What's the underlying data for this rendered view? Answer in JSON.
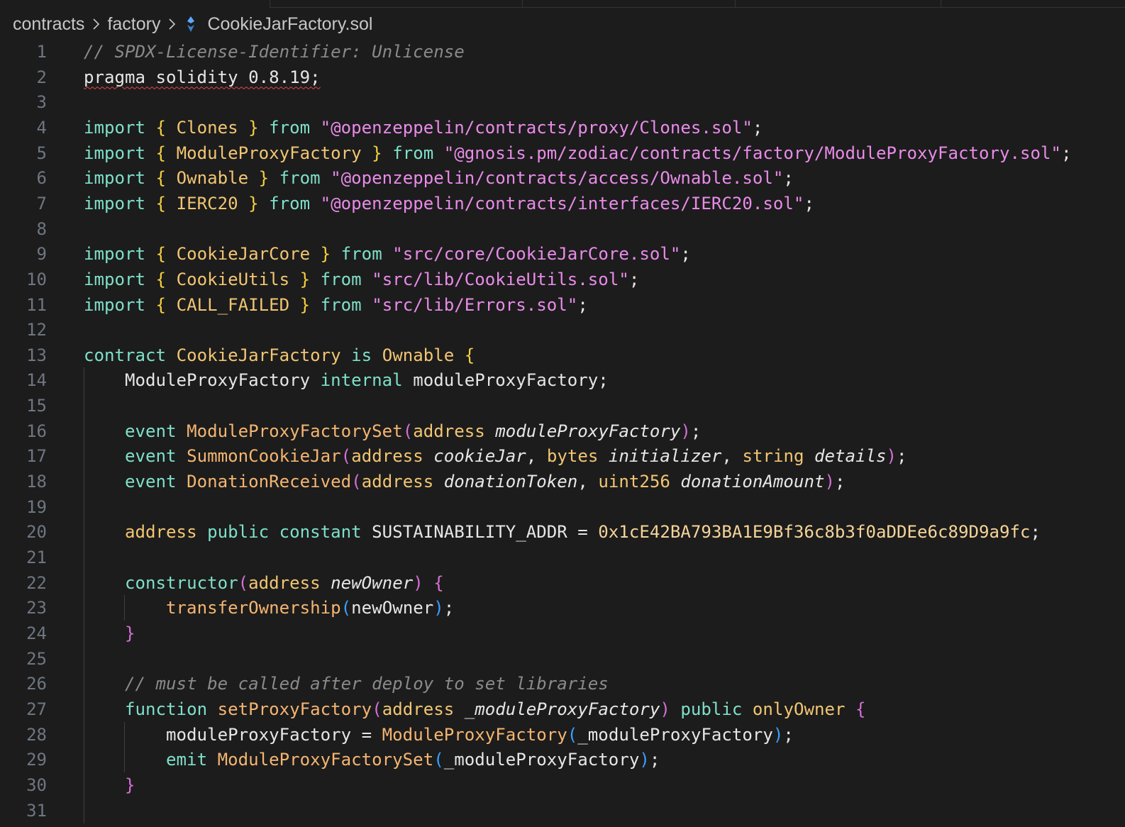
{
  "breadcrumb": {
    "items": [
      "contracts",
      "factory"
    ],
    "file": "CookieJarFactory.sol",
    "file_icon": "solidity-file-icon"
  },
  "editor": {
    "lines": [
      {
        "n": "1",
        "tokens": [
          [
            "cm",
            "// SPDX-License-Identifier: Unlicense"
          ]
        ]
      },
      {
        "n": "2",
        "tokens": [
          [
            "plain squig",
            "pragma solidity 0.8.19;"
          ]
        ]
      },
      {
        "n": "3",
        "tokens": []
      },
      {
        "n": "4",
        "tokens": [
          [
            "kw",
            "import "
          ],
          [
            "br",
            "{ "
          ],
          [
            "ty",
            "Clones "
          ],
          [
            "br",
            "} "
          ],
          [
            "kw",
            "from "
          ],
          [
            "str",
            "\"@openzeppelin/contracts/proxy/Clones.sol\""
          ],
          [
            "plain",
            ";"
          ]
        ]
      },
      {
        "n": "5",
        "tokens": [
          [
            "kw",
            "import "
          ],
          [
            "br",
            "{ "
          ],
          [
            "ty",
            "ModuleProxyFactory "
          ],
          [
            "br",
            "} "
          ],
          [
            "kw",
            "from "
          ],
          [
            "str",
            "\"@gnosis.pm/zodiac/contracts/factory/ModuleProxyFactory.sol\""
          ],
          [
            "plain",
            ";"
          ]
        ]
      },
      {
        "n": "6",
        "tokens": [
          [
            "kw",
            "import "
          ],
          [
            "br",
            "{ "
          ],
          [
            "ty",
            "Ownable "
          ],
          [
            "br",
            "} "
          ],
          [
            "kw",
            "from "
          ],
          [
            "str",
            "\"@openzeppelin/contracts/access/Ownable.sol\""
          ],
          [
            "plain",
            ";"
          ]
        ]
      },
      {
        "n": "7",
        "tokens": [
          [
            "kw",
            "import "
          ],
          [
            "br",
            "{ "
          ],
          [
            "ty",
            "IERC20 "
          ],
          [
            "br",
            "} "
          ],
          [
            "kw",
            "from "
          ],
          [
            "str",
            "\"@openzeppelin/contracts/interfaces/IERC20.sol\""
          ],
          [
            "plain",
            ";"
          ]
        ]
      },
      {
        "n": "8",
        "tokens": []
      },
      {
        "n": "9",
        "tokens": [
          [
            "kw",
            "import "
          ],
          [
            "br",
            "{ "
          ],
          [
            "ty",
            "CookieJarCore "
          ],
          [
            "br",
            "} "
          ],
          [
            "kw",
            "from "
          ],
          [
            "str",
            "\"src/core/CookieJarCore.sol\""
          ],
          [
            "plain",
            ";"
          ]
        ]
      },
      {
        "n": "10",
        "tokens": [
          [
            "kw",
            "import "
          ],
          [
            "br",
            "{ "
          ],
          [
            "ty",
            "CookieUtils "
          ],
          [
            "br",
            "} "
          ],
          [
            "kw",
            "from "
          ],
          [
            "str",
            "\"src/lib/CookieUtils.sol\""
          ],
          [
            "plain",
            ";"
          ]
        ]
      },
      {
        "n": "11",
        "tokens": [
          [
            "kw",
            "import "
          ],
          [
            "br",
            "{ "
          ],
          [
            "ty",
            "CALL_FAILED "
          ],
          [
            "br",
            "} "
          ],
          [
            "kw",
            "from "
          ],
          [
            "str",
            "\"src/lib/Errors.sol\""
          ],
          [
            "plain",
            ";"
          ]
        ]
      },
      {
        "n": "12",
        "tokens": []
      },
      {
        "n": "13",
        "tokens": [
          [
            "kw",
            "contract "
          ],
          [
            "ty",
            "CookieJarFactory "
          ],
          [
            "kw",
            "is "
          ],
          [
            "ty",
            "Ownable "
          ],
          [
            "br",
            "{"
          ]
        ]
      },
      {
        "n": "14",
        "tokens": [
          [
            "plain",
            "    ModuleProxyFactory "
          ],
          [
            "kw",
            "internal "
          ],
          [
            "plain",
            "moduleProxyFactory;"
          ]
        ]
      },
      {
        "n": "15",
        "tokens": []
      },
      {
        "n": "16",
        "tokens": [
          [
            "plain",
            "    "
          ],
          [
            "kw",
            "event "
          ],
          [
            "fn",
            "ModuleProxyFactorySet"
          ],
          [
            "brm",
            "("
          ],
          [
            "ty",
            "address "
          ],
          [
            "it",
            "moduleProxyFactory"
          ],
          [
            "brm",
            ")"
          ],
          [
            "plain",
            ";"
          ]
        ]
      },
      {
        "n": "17",
        "tokens": [
          [
            "plain",
            "    "
          ],
          [
            "kw",
            "event "
          ],
          [
            "fn",
            "SummonCookieJar"
          ],
          [
            "brm",
            "("
          ],
          [
            "ty",
            "address "
          ],
          [
            "it",
            "cookieJar"
          ],
          [
            "plain",
            ", "
          ],
          [
            "ty",
            "bytes "
          ],
          [
            "it",
            "initializer"
          ],
          [
            "plain",
            ", "
          ],
          [
            "ty",
            "string "
          ],
          [
            "it",
            "details"
          ],
          [
            "brm",
            ")"
          ],
          [
            "plain",
            ";"
          ]
        ]
      },
      {
        "n": "18",
        "tokens": [
          [
            "plain",
            "    "
          ],
          [
            "kw",
            "event "
          ],
          [
            "fn",
            "DonationReceived"
          ],
          [
            "brm",
            "("
          ],
          [
            "ty",
            "address "
          ],
          [
            "it",
            "donationToken"
          ],
          [
            "plain",
            ", "
          ],
          [
            "ty",
            "uint256 "
          ],
          [
            "it",
            "donationAmount"
          ],
          [
            "brm",
            ")"
          ],
          [
            "plain",
            ";"
          ]
        ]
      },
      {
        "n": "19",
        "tokens": []
      },
      {
        "n": "20",
        "tokens": [
          [
            "plain",
            "    "
          ],
          [
            "ty",
            "address "
          ],
          [
            "kw",
            "public constant "
          ],
          [
            "plain",
            "SUSTAINABILITY_ADDR = "
          ],
          [
            "num",
            "0x1cE42BA793BA1E9Bf36c8b3f0aDDEe6c89D9a9fc"
          ],
          [
            "plain",
            ";"
          ]
        ]
      },
      {
        "n": "21",
        "tokens": []
      },
      {
        "n": "22",
        "tokens": [
          [
            "plain",
            "    "
          ],
          [
            "kw",
            "constructor"
          ],
          [
            "brm",
            "("
          ],
          [
            "ty",
            "address "
          ],
          [
            "it",
            "newOwner"
          ],
          [
            "brm",
            ") {"
          ]
        ]
      },
      {
        "n": "23",
        "tokens": [
          [
            "plain",
            "        "
          ],
          [
            "fn",
            "transferOwnership"
          ],
          [
            "brb",
            "("
          ],
          [
            "plain",
            "newOwner"
          ],
          [
            "brb",
            ")"
          ],
          [
            "plain",
            ";"
          ]
        ]
      },
      {
        "n": "24",
        "tokens": [
          [
            "plain",
            "    "
          ],
          [
            "brm",
            "}"
          ]
        ]
      },
      {
        "n": "25",
        "tokens": []
      },
      {
        "n": "26",
        "tokens": [
          [
            "plain",
            "    "
          ],
          [
            "cm",
            "// must be called after deploy to set libraries"
          ]
        ]
      },
      {
        "n": "27",
        "tokens": [
          [
            "plain",
            "    "
          ],
          [
            "kw",
            "function "
          ],
          [
            "fn",
            "setProxyFactory"
          ],
          [
            "brm",
            "("
          ],
          [
            "ty",
            "address "
          ],
          [
            "it",
            "_moduleProxyFactory"
          ],
          [
            "brm",
            ") "
          ],
          [
            "kw",
            "public "
          ],
          [
            "ty",
            "onlyOwner "
          ],
          [
            "brm",
            "{"
          ]
        ]
      },
      {
        "n": "28",
        "tokens": [
          [
            "plain",
            "        moduleProxyFactory = "
          ],
          [
            "fn",
            "ModuleProxyFactory"
          ],
          [
            "brb",
            "("
          ],
          [
            "plain",
            "_moduleProxyFactory"
          ],
          [
            "brb",
            ")"
          ],
          [
            "plain",
            ";"
          ]
        ]
      },
      {
        "n": "29",
        "tokens": [
          [
            "plain",
            "        "
          ],
          [
            "kw",
            "emit "
          ],
          [
            "fn",
            "ModuleProxyFactorySet"
          ],
          [
            "brb",
            "("
          ],
          [
            "plain",
            "_moduleProxyFactory"
          ],
          [
            "brb",
            ")"
          ],
          [
            "plain",
            ";"
          ]
        ]
      },
      {
        "n": "30",
        "tokens": [
          [
            "plain",
            "    "
          ],
          [
            "brm",
            "}"
          ]
        ]
      },
      {
        "n": "31",
        "tokens": []
      }
    ]
  }
}
